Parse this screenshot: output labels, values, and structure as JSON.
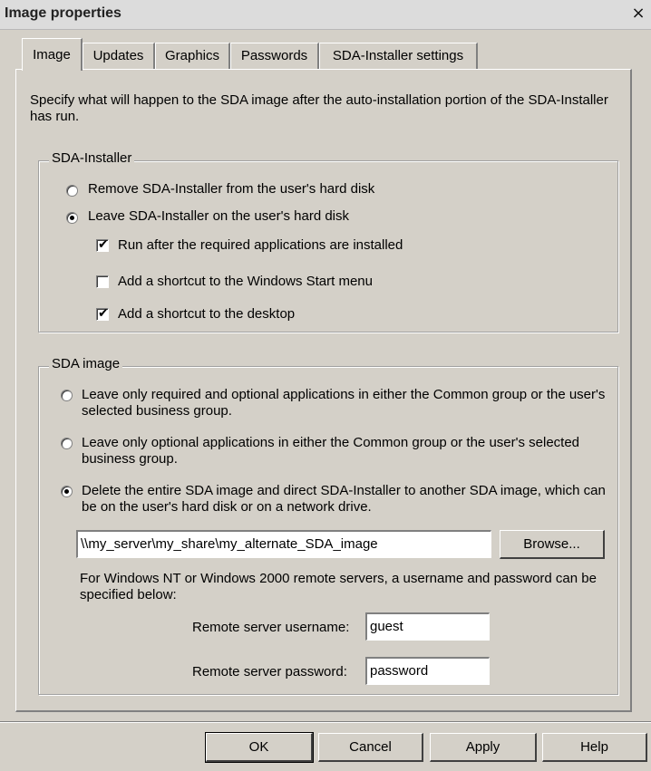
{
  "window": {
    "title": "Image properties",
    "close_glyph": "×"
  },
  "tabs": [
    {
      "label": "Image",
      "active": true
    },
    {
      "label": "Updates",
      "active": false
    },
    {
      "label": "Graphics",
      "active": false
    },
    {
      "label": "Passwords",
      "active": false
    },
    {
      "label": "SDA-Installer settings",
      "active": false
    }
  ],
  "intro_text": "Specify what will happen to the SDA image after the auto-installation portion of the SDA-Installer has run.",
  "sda_installer": {
    "group_title": "SDA-Installer",
    "remove_label": "Remove SDA-Installer from the user's hard disk",
    "leave_label": "Leave SDA-Installer on the user's hard disk",
    "selected": "leave",
    "run_after_label": "Run after the required applications are installed",
    "run_after_checked": true,
    "start_menu_label": "Add a shortcut to the Windows Start menu",
    "start_menu_checked": false,
    "desktop_label": "Add a shortcut to the desktop",
    "desktop_checked": true
  },
  "sda_image": {
    "group_title": "SDA image",
    "option1_label": "Leave only required and optional applications in either the Common group or the user's selected business group.",
    "option2_label": "Leave only optional applications in either the Common group or the user's selected business group.",
    "option3_label": "Delete the entire SDA image and direct SDA-Installer to another SDA image, which can be on the user's hard disk or on a network drive.",
    "selected": "option3",
    "path_value": "\\\\my_server\\my_share\\my_alternate_SDA_image",
    "browse_label": "Browse...",
    "remote_note": "For Windows NT or Windows 2000 remote servers, a username and password can be specified below:",
    "username_label": "Remote server username:",
    "username_value": "guest",
    "password_label": "Remote server password:",
    "password_value": "password"
  },
  "footer": {
    "ok_label": "OK",
    "cancel_label": "Cancel",
    "apply_label": "Apply",
    "help_label": "Help"
  },
  "icons": {
    "radio_selected": "radio-dot",
    "check_mark": "✔"
  }
}
